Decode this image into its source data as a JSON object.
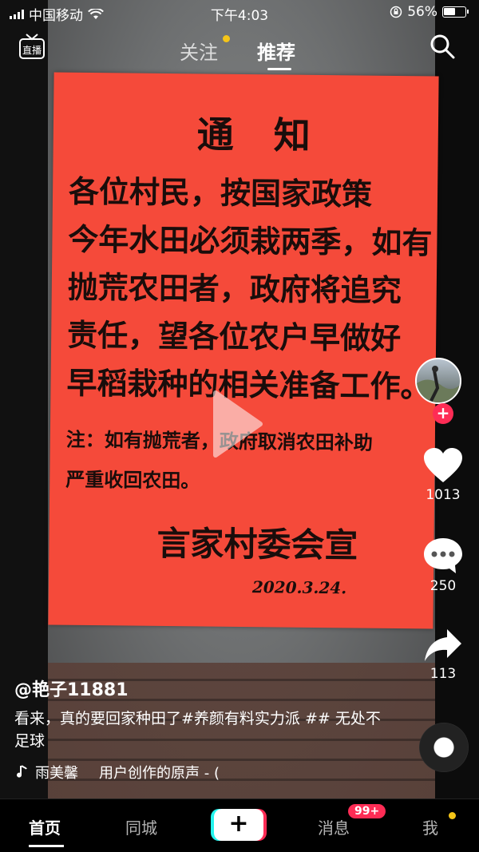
{
  "status_bar": {
    "carrier": "中国移动",
    "time": "下午4:03",
    "battery_percent": "56%",
    "battery_level": 0.56
  },
  "top_nav": {
    "live_label": "直播",
    "tab_follow": "关注",
    "tab_recommend": "推荐",
    "active_tab": "推荐"
  },
  "notice": {
    "title": "通知",
    "lines": [
      "各位村民，按国家政策",
      "今年水田必须栽两季，如有",
      "抛荒农田者，政府将追究",
      "责任，望各位农户早做好",
      "早稻栽种的相关准备工作。"
    ],
    "note_lines": [
      "注：如有抛荒者，政府取消农田补助",
      "严重收回农田。"
    ],
    "signature": "言家村委会宣",
    "date": "2020.3.24."
  },
  "actions": {
    "likes": "1013",
    "comments": "250",
    "shares": "113"
  },
  "post": {
    "author": "@艳子11881",
    "caption": "看来，真的要回家种田了#养颜有料实力派 ## 无处不足球",
    "music_artist": "雨美馨",
    "music_title": "用户创作的原声 - ("
  },
  "tab_bar": {
    "home": "首页",
    "city": "同城",
    "create": "+",
    "messages": "消息",
    "messages_badge": "99+",
    "me": "我"
  },
  "colors": {
    "accent_red": "#fe2c55",
    "accent_cyan": "#25f4ee",
    "notice_red": "#f54a3a",
    "dot_yellow": "#f5c518"
  }
}
